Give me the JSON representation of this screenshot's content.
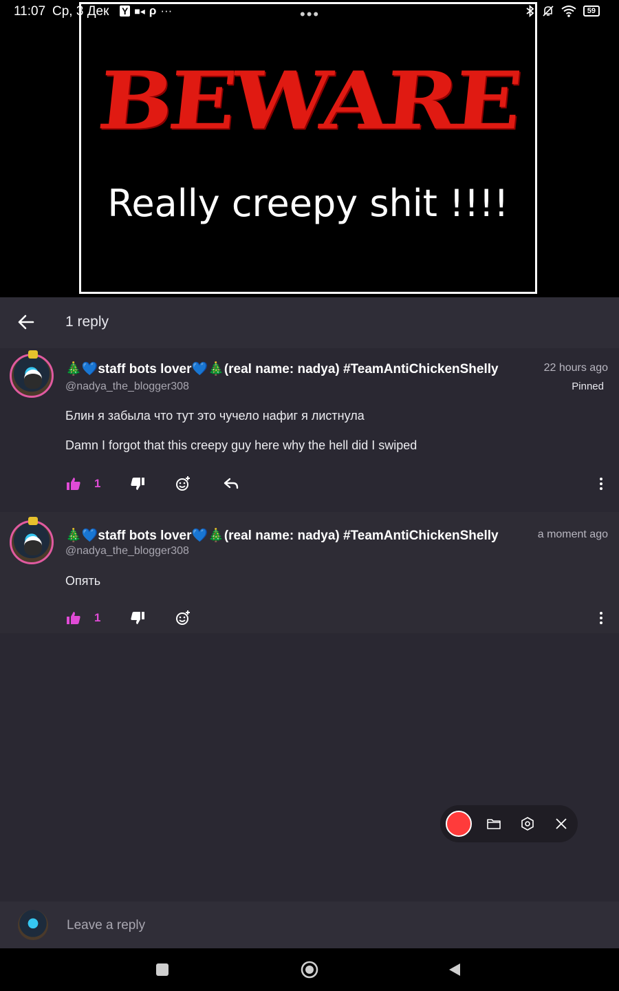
{
  "status_bar": {
    "time": "11:07",
    "date": "Ср, 3 Дек",
    "app_icons": [
      "Y",
      "■◂",
      "ρ",
      "···"
    ],
    "battery": "59"
  },
  "video": {
    "headline": "BEWARE",
    "caption": "Really creepy shit !!!!",
    "menu": "•••"
  },
  "header": {
    "title": "1 reply"
  },
  "comments": [
    {
      "username": "🎄💙staff bots lover💙🎄(real name: nadya) #TeamAntiChickenShelly",
      "handle": "@nadya_the_blogger308",
      "time": "22 hours ago",
      "pinned": "Pinned",
      "lines": [
        "Блин я забыла что тут это чучело нафиг я листнула",
        "Damn I forgot that this creepy guy here why the hell did I swiped"
      ],
      "likes": "1"
    },
    {
      "username": "🎄💙staff bots lover💙🎄(real name: nadya) #TeamAntiChickenShelly",
      "handle": "@nadya_the_blogger308",
      "time": "a moment ago",
      "lines": [
        "Опять"
      ],
      "likes": "1"
    }
  ],
  "reply_box": {
    "placeholder": "Leave a reply"
  },
  "colors": {
    "accent": "#e04bd6",
    "record": "#ff3b3b",
    "background": "#2a2832"
  },
  "icons": [
    "arrow-left-icon",
    "thumb-up-icon",
    "thumb-down-icon",
    "emoji-add-icon",
    "reply-icon",
    "more-vertical-icon",
    "folder-icon",
    "settings-icon",
    "close-icon"
  ]
}
